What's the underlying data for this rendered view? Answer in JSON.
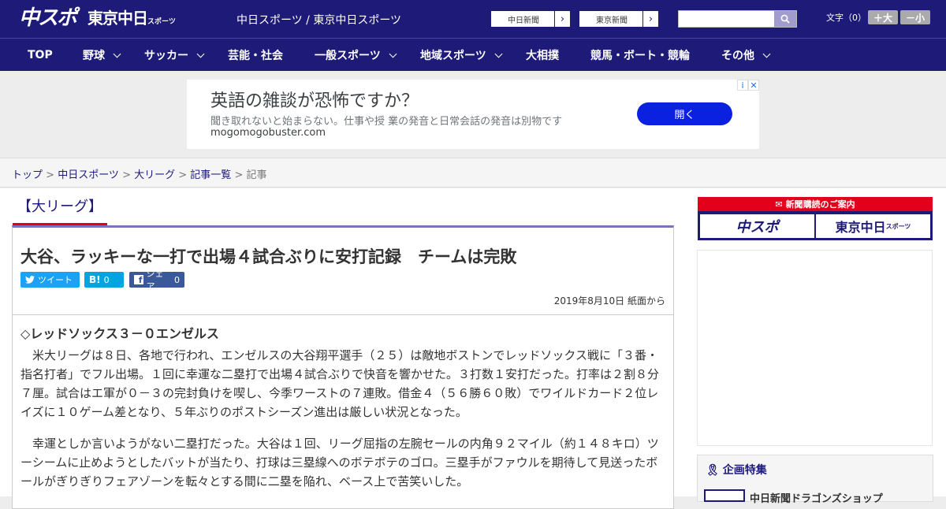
{
  "header": {
    "logo_chusupo": "中スポ",
    "logo_tokyo": "東京中日",
    "logo_tokyo_sub": "スポーツ",
    "site_names": "中日スポーツ / 東京中日スポーツ",
    "paper_links": [
      "中日新聞",
      "東京新聞"
    ],
    "search_placeholder": "",
    "font_size_label": "文字（0）",
    "font_plus": "＋大",
    "font_minus": "－小"
  },
  "nav": {
    "items": [
      {
        "label": "TOP",
        "dropdown": false
      },
      {
        "label": "野球",
        "dropdown": true
      },
      {
        "label": "サッカー",
        "dropdown": true
      },
      {
        "label": "芸能・社会",
        "dropdown": false
      },
      {
        "label": "一般スポーツ",
        "dropdown": true
      },
      {
        "label": "地域スポーツ",
        "dropdown": true
      },
      {
        "label": "大相撲",
        "dropdown": false
      },
      {
        "label": "競馬・ボート・競輪",
        "dropdown": false
      },
      {
        "label": "その他",
        "dropdown": true
      }
    ]
  },
  "ad": {
    "headline": "英語の雑談が恐怖ですか？",
    "body": "聞き取れないと始まらない。仕事や授 業の発音と日常会話の発音は別物です",
    "url": "mogomogobuster.com",
    "cta": "開く"
  },
  "breadcrumb": {
    "items": [
      "トップ",
      "中日スポーツ",
      "大リーグ",
      "記事一覧"
    ],
    "current": "記事",
    "separator": " > "
  },
  "article": {
    "category": "【大リーグ】",
    "title": "大谷、ラッキーな一打で出場４試合ぶりに安打記録　チームは完敗",
    "share": {
      "tweet": "ツイート",
      "hatena_label": "B!",
      "hatena_count": "0",
      "facebook": "シェア",
      "facebook_count": "0"
    },
    "date": "2019年8月10日 紙面から",
    "lead": "◇レッドソックス３－０エンゼルス",
    "paragraphs": [
      "　米大リーグは８日、各地で行われ、エンゼルスの大谷翔平選手（２５）は敵地ボストンでレッドソックス戦に「３番・指名打者」でフル出場。１回に幸運な二塁打で出場４試合ぶりで快音を響かせた。３打数１安打だった。打率は２割８分７厘。試合はエ軍が０－３の完封負けを喫し、今季ワーストの７連敗。借金４（５６勝６０敗）でワイルドカード２位レイズに１０ゲーム差となり、５年ぶりのポストシーズン進出は厳しい状況となった。",
      "　幸運としか言いようがない二塁打だった。大谷は１回、リーグ屈指の左腕セールの内角９２マイル（約１４８キロ）ツーシームに止めようとしたバットが当たり、打球は三塁線へのボテボテのゴロ。三塁手がファウルを期待して見送ったボールがぎりぎりフェアゾーンを転々とする間に二塁を陥れ、ベース上で苦笑いした。"
    ]
  },
  "sidebar": {
    "subscribe_title": "新聞購読のご案内",
    "subscribe_chusupo": "中スポ",
    "subscribe_tokyo": "東京中日",
    "subscribe_tokyo_sub": "スポーツ",
    "feature_title": "企画特集",
    "feature_item": "中日新聞ドラゴンズショップ"
  },
  "colors": {
    "brand": "#1d1a78",
    "accent_red": "#e2001a",
    "twitter": "#1da1f2",
    "hatena": "#00a4de",
    "facebook": "#3b5998",
    "ad_button": "#0b21e0"
  }
}
